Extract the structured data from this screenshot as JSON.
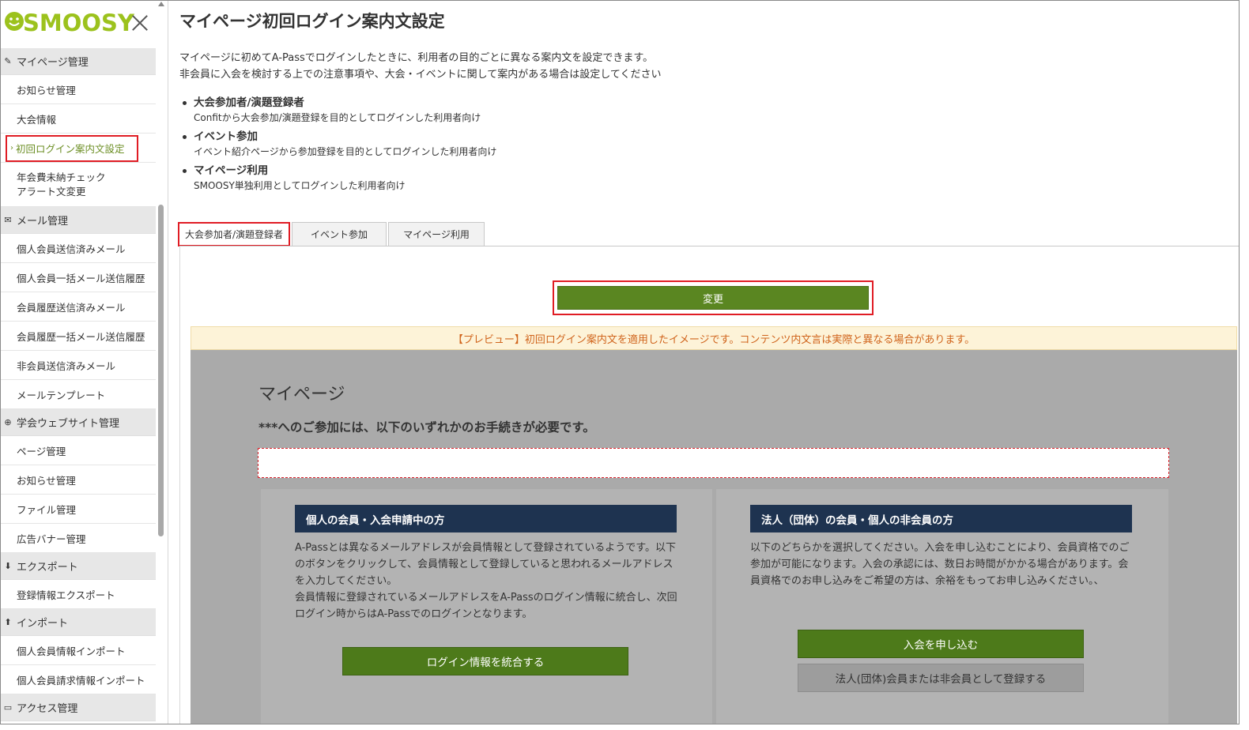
{
  "app": {
    "logo_text": "SMOOSY"
  },
  "sidebar": {
    "sections": [
      {
        "title": "マイページ管理",
        "icon": "pencil-icon",
        "items": [
          {
            "label": "お知らせ管理"
          },
          {
            "label": "大会情報"
          },
          {
            "label": "初回ログイン案内文設定",
            "active": true
          },
          {
            "label": "年会費未納チェック\nアラート文変更"
          }
        ]
      },
      {
        "title": "メール管理",
        "icon": "envelope-icon",
        "items": [
          {
            "label": "個人会員送信済みメール"
          },
          {
            "label": "個人会員一括メール送信履歴"
          },
          {
            "label": "会員履歴送信済みメール"
          },
          {
            "label": "会員履歴一括メール送信履歴"
          },
          {
            "label": "非会員送信済みメール"
          },
          {
            "label": "メールテンプレート"
          }
        ]
      },
      {
        "title": "学会ウェブサイト管理",
        "icon": "globe-icon",
        "items": [
          {
            "label": "ページ管理"
          },
          {
            "label": "お知らせ管理"
          },
          {
            "label": "ファイル管理"
          },
          {
            "label": "広告バナー管理"
          }
        ]
      },
      {
        "title": "エクスポート",
        "icon": "download-icon",
        "items": [
          {
            "label": "登録情報エクスポート"
          }
        ]
      },
      {
        "title": "インポート",
        "icon": "upload-icon",
        "items": [
          {
            "label": "個人会員情報インポート"
          },
          {
            "label": "個人会員請求情報インポート"
          }
        ]
      },
      {
        "title": "アクセス管理",
        "icon": "monitor-icon",
        "items": []
      }
    ]
  },
  "main": {
    "title": "マイページ初回ログイン案内文設定",
    "desc_line1": "マイページに初めてA-Passでログインしたときに、利用者の目的ごとに異なる案内文を設定できます。",
    "desc_line2": "非会員に入会を検討する上での注意事項や、大会・イベントに関して案内がある場合は設定してください",
    "bullets": [
      {
        "title": "大会参加者/演題登録者",
        "desc": "Confitから大会参加/演題登録を目的としてログインした利用者向け"
      },
      {
        "title": "イベント参加",
        "desc": "イベント紹介ページから参加登録を目的としてログインした利用者向け"
      },
      {
        "title": "マイページ利用",
        "desc": "SMOOSY単独利用としてログインした利用者向け"
      }
    ],
    "tabs": [
      {
        "label": "大会参加者/演題登録者",
        "active": true
      },
      {
        "label": "イベント参加"
      },
      {
        "label": "マイページ利用"
      }
    ],
    "change_button": "変更",
    "preview_notice": "【プレビュー】初回ログイン案内文を適用したイメージです。コンテンツ内文言は実際と異なる場合があります。",
    "preview": {
      "title": "マイページ",
      "subtitle": "***へのご参加には、以下のいずれかのお手続きが必要です。",
      "input_value": "",
      "card_left": {
        "heading": "個人の会員・入会申請中の方",
        "text": "A-Passとは異なるメールアドレスが会員情報として登録されているようです。以下のボタンをクリックして、会員情報として登録していると思われるメールアドレスを入力してください。\n会員情報に登録されているメールアドレスをA-Passのログイン情報に統合し、次回ログイン時からはA-Passでのログインとなります。",
        "button": "ログイン情報を統合する"
      },
      "card_right": {
        "heading": "法人（団体）の会員・個人の非会員の方",
        "text": "以下のどちらかを選択してください。入会を申し込むことにより、会員資格でのご参加が可能になります。入会の承認には、数日お時間がかかる場合があります。会員資格でのお申し込みをご希望の方は、余裕をもってお申し込みください。、",
        "button_primary": "入会を申し込む",
        "button_secondary": "法人(団体)会員または非会員として登録する"
      }
    }
  },
  "colors": {
    "accent_green": "#5a8621",
    "logo_green": "#9cc21d",
    "highlight_red": "#e01c24",
    "card_header_navy": "#1e3350",
    "notice_text": "#d0641c"
  }
}
